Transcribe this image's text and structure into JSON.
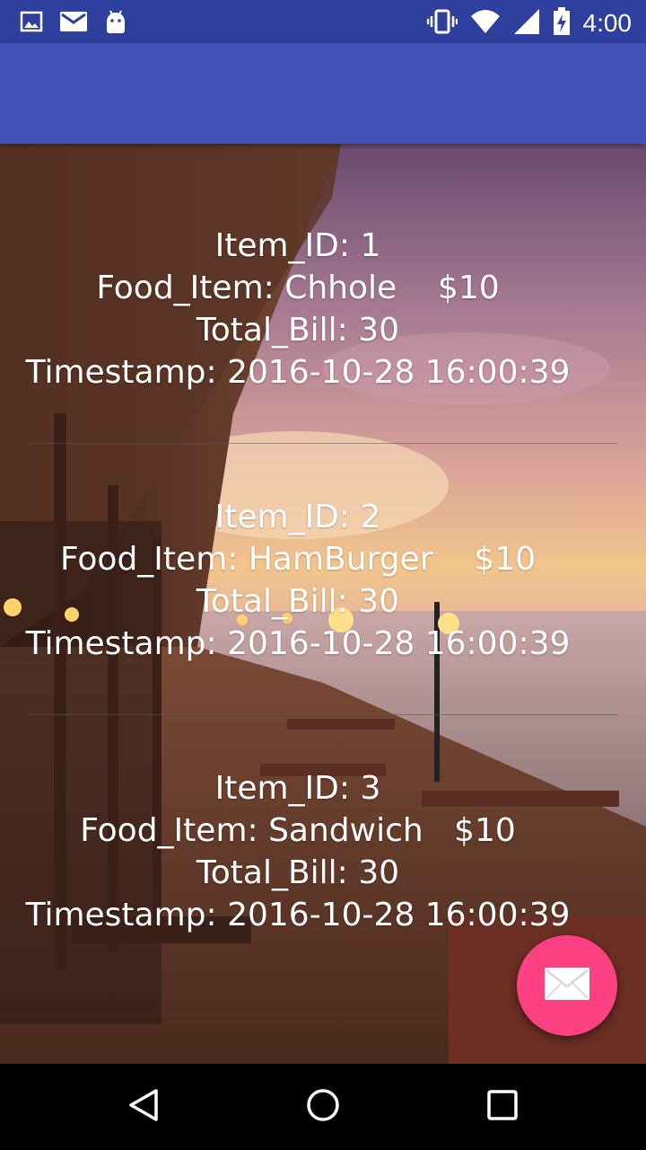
{
  "status_bar": {
    "time": "4:00",
    "left_icons": [
      "image-icon",
      "mail-icon",
      "android-icon"
    ],
    "right_icons": [
      "vibrate-icon",
      "wifi-icon",
      "signal-icon",
      "battery-charging-icon"
    ]
  },
  "app_bar": {
    "title": ""
  },
  "orders": [
    {
      "item_id": "Item_ID: 1",
      "food_item": "Food_Item: Chhole    $10",
      "total_bill": "Total_Bill: 30",
      "timestamp": "Timestamp: 2016-10-28 16:00:39"
    },
    {
      "item_id": "Item_ID: 2",
      "food_item": "Food_Item: HamBurger    $10",
      "total_bill": "Total_Bill: 30",
      "timestamp": "Timestamp: 2016-10-28 16:00:39"
    },
    {
      "item_id": "Item_ID: 3",
      "food_item": "Food_Item: Sandwich   $10",
      "total_bill": "Total_Bill: 30",
      "timestamp": "Timestamp: 2016-10-28 16:00:39"
    }
  ],
  "fab": {
    "icon": "envelope-icon",
    "color": "#ff4081"
  },
  "colors": {
    "status_bar": "#2f3f9e",
    "app_bar": "#3f51b5",
    "text": "#ffffff"
  },
  "nav_bar": {
    "icons": [
      "back-icon",
      "home-icon",
      "recents-icon"
    ]
  }
}
